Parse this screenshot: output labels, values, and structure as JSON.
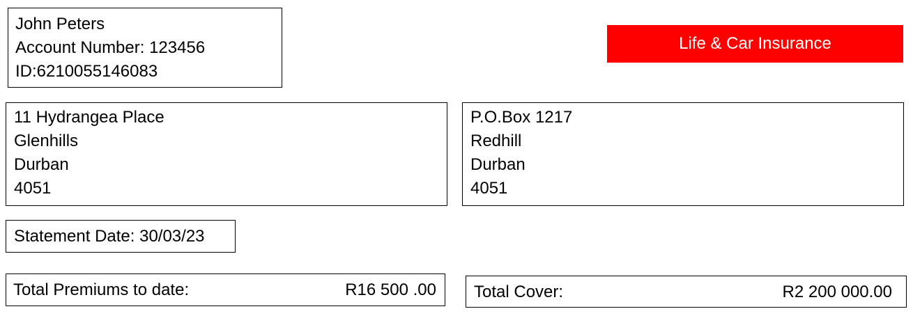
{
  "customer": {
    "name": "John Peters",
    "account_number": "Account Number: 123456",
    "id_number": "ID:6210055146083"
  },
  "banner": {
    "label": "Life & Car Insurance",
    "color": "#ff0000"
  },
  "residential_address": {
    "line1": "11 Hydrangea Place",
    "line2": "Glenhills",
    "line3": "Durban",
    "line4": "4051"
  },
  "postal_address": {
    "line1": "P.O.Box 1217",
    "line2": "Redhill",
    "line3": "Durban",
    "line4": "4051"
  },
  "statement": {
    "date": "Statement Date: 30/03/23"
  },
  "totals": {
    "premiums_label": "Total Premiums to date:",
    "premiums_value": "R16 500 .00",
    "cover_label": "Total Cover:",
    "cover_value": "R2 200 000.00"
  }
}
